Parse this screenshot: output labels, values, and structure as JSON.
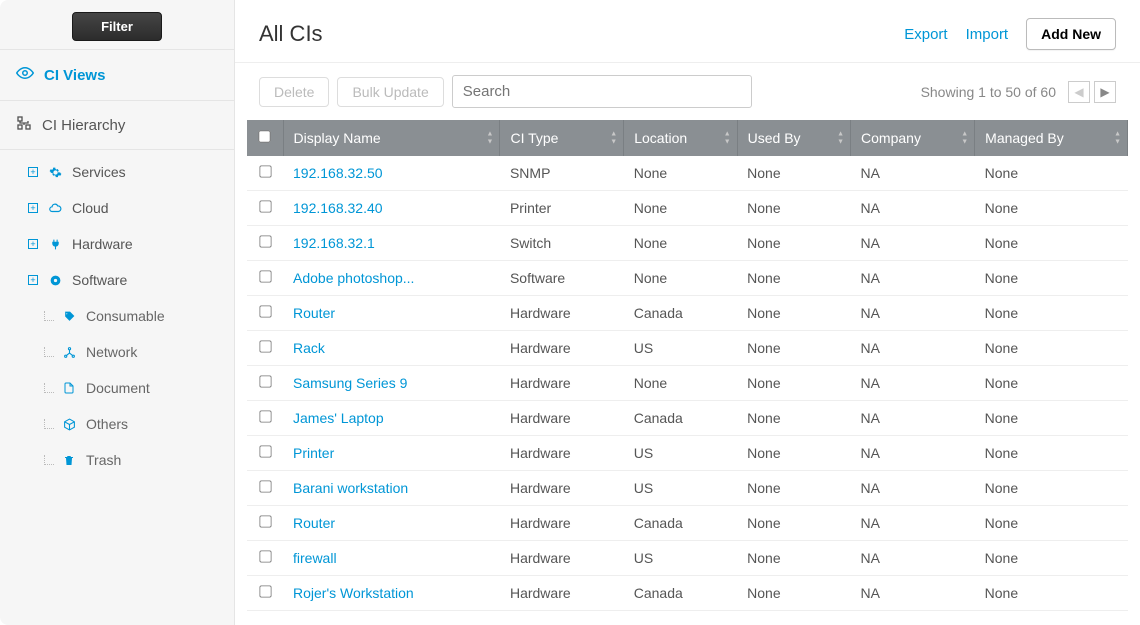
{
  "sidebar": {
    "filter_label": "Filter",
    "views_label": "CI Views",
    "hierarchy_label": "CI Hierarchy",
    "items": [
      {
        "label": "Services",
        "icon": "gear-icon",
        "expandable": true
      },
      {
        "label": "Cloud",
        "icon": "cloud-icon",
        "expandable": true
      },
      {
        "label": "Hardware",
        "icon": "plug-icon",
        "expandable": true
      },
      {
        "label": "Software",
        "icon": "disc-icon",
        "expandable": true
      },
      {
        "label": "Consumable",
        "icon": "tag-icon",
        "sub": true
      },
      {
        "label": "Network",
        "icon": "network-icon",
        "sub": true
      },
      {
        "label": "Document",
        "icon": "document-icon",
        "sub": true
      },
      {
        "label": "Others",
        "icon": "cube-icon",
        "sub": true
      },
      {
        "label": "Trash",
        "icon": "trash-icon",
        "sub": true
      }
    ]
  },
  "header": {
    "title": "All CIs",
    "export_label": "Export",
    "import_label": "Import",
    "add_new_label": "Add New"
  },
  "toolbar": {
    "delete_label": "Delete",
    "bulk_update_label": "Bulk Update",
    "search_placeholder": "Search",
    "showing_text": "Showing 1 to 50 of 60"
  },
  "table": {
    "columns": [
      "Display Name",
      "CI Type",
      "Location",
      "Used By",
      "Company",
      "Managed By"
    ],
    "rows": [
      {
        "display": "192.168.32.50",
        "type": "SNMP",
        "location": "None",
        "used_by": "None",
        "company": "NA",
        "managed_by": "None"
      },
      {
        "display": "192.168.32.40",
        "type": "Printer",
        "location": "None",
        "used_by": "None",
        "company": "NA",
        "managed_by": "None"
      },
      {
        "display": "192.168.32.1",
        "type": "Switch",
        "location": "None",
        "used_by": "None",
        "company": "NA",
        "managed_by": "None"
      },
      {
        "display": "Adobe photoshop...",
        "type": "Software",
        "location": "None",
        "used_by": "None",
        "company": "NA",
        "managed_by": "None"
      },
      {
        "display": "Router",
        "type": "Hardware",
        "location": "Canada",
        "used_by": "None",
        "company": "NA",
        "managed_by": "None"
      },
      {
        "display": "Rack",
        "type": "Hardware",
        "location": "US",
        "used_by": "None",
        "company": "NA",
        "managed_by": "None"
      },
      {
        "display": "Samsung Series 9",
        "type": "Hardware",
        "location": "None",
        "used_by": "None",
        "company": "NA",
        "managed_by": "None"
      },
      {
        "display": "James' Laptop",
        "type": "Hardware",
        "location": "Canada",
        "used_by": "None",
        "company": "NA",
        "managed_by": "None"
      },
      {
        "display": "Printer",
        "type": "Hardware",
        "location": "US",
        "used_by": "None",
        "company": "NA",
        "managed_by": "None"
      },
      {
        "display": "Barani workstation",
        "type": "Hardware",
        "location": "US",
        "used_by": "None",
        "company": "NA",
        "managed_by": "None"
      },
      {
        "display": "Router",
        "type": "Hardware",
        "location": "Canada",
        "used_by": "None",
        "company": "NA",
        "managed_by": "None"
      },
      {
        "display": "firewall",
        "type": "Hardware",
        "location": "US",
        "used_by": "None",
        "company": "NA",
        "managed_by": "None"
      },
      {
        "display": "Rojer's Workstation",
        "type": "Hardware",
        "location": "Canada",
        "used_by": "None",
        "company": "NA",
        "managed_by": "None"
      }
    ]
  }
}
